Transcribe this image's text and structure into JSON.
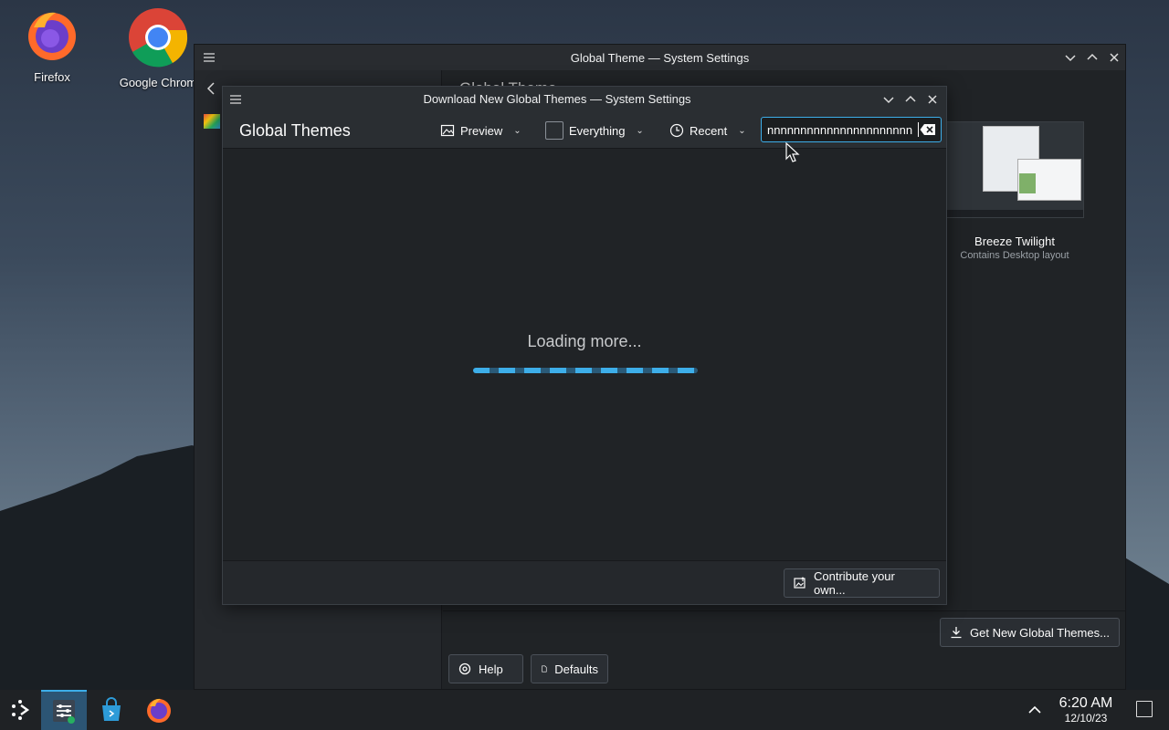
{
  "desktop": {
    "icons": [
      {
        "label": "Firefox",
        "icon": "firefox-icon"
      },
      {
        "label": "Google Chrom",
        "icon": "chrome-icon"
      }
    ]
  },
  "system_settings": {
    "title": "Global Theme — System Settings",
    "heading": "Global Theme",
    "theme_card": {
      "name": "Breeze Twilight",
      "subtitle": "Contains Desktop layout"
    },
    "get_new_button": "Get New Global Themes...",
    "help_button": "Help",
    "defaults_button": "Defaults"
  },
  "dialog": {
    "title": "Download New Global Themes — System Settings",
    "heading": "Global Themes",
    "toolbar": {
      "preview": "Preview",
      "everything": "Everything",
      "recent": "Recent",
      "search_value": "nnnnnnnnnnnnnnnnnnnnnn"
    },
    "loading_text": "Loading more...",
    "contribute_button": "Contribute your own..."
  },
  "taskbar": {
    "time": "6:20 AM",
    "date": "12/10/23"
  },
  "colors": {
    "accent": "#3daee9",
    "window_bg": "#202326",
    "titlebar": "#2a2e32"
  }
}
